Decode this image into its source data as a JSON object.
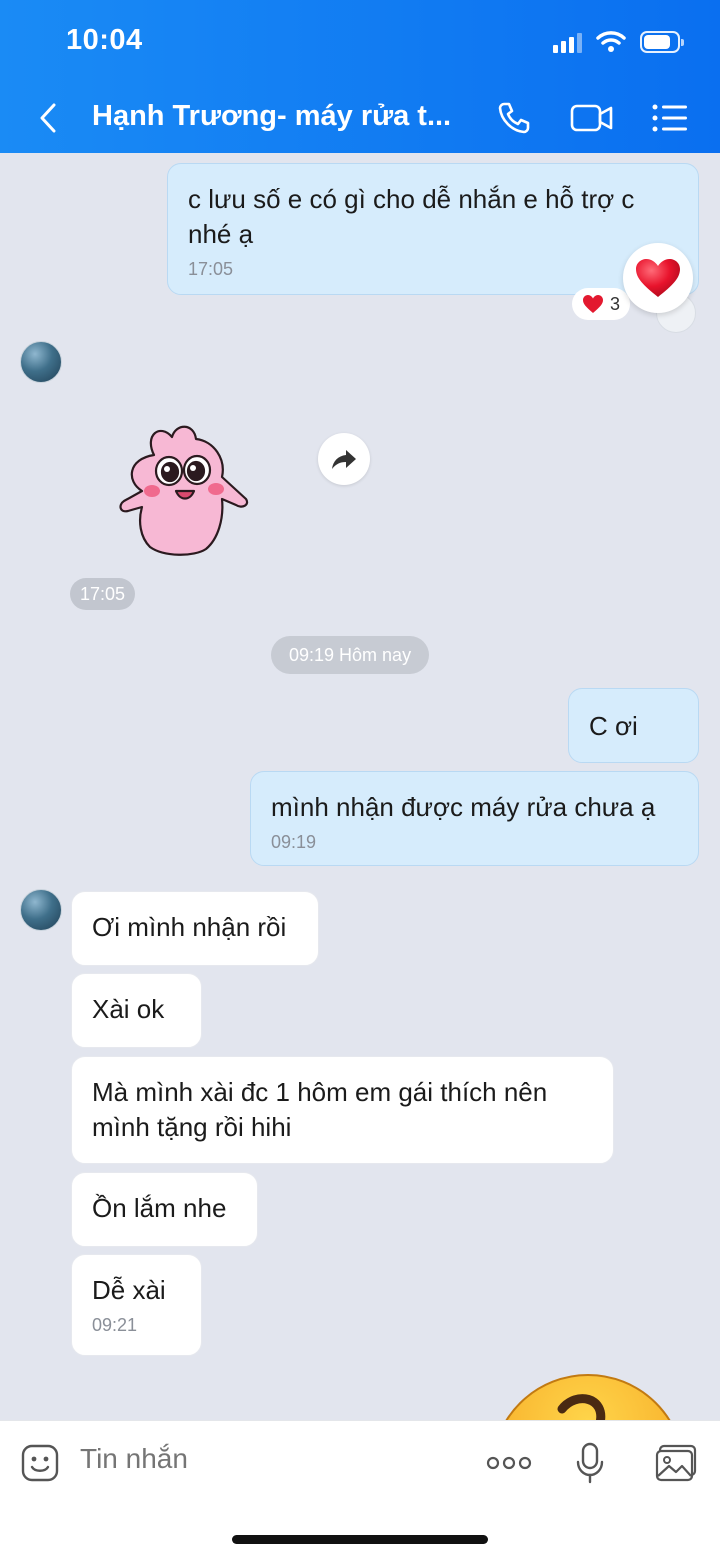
{
  "status_bar": {
    "time": "10:04"
  },
  "header": {
    "title": "Hạnh Trương- máy rửa t..."
  },
  "messages": {
    "m1": {
      "text": "c lưu số e có gì cho dễ nhắn e hỗ trợ c nhé ạ",
      "time": "17:05",
      "reaction_count": "3"
    },
    "sticker_time": "17:05",
    "date_separator": "09:19 Hôm nay",
    "m2": {
      "text": "C ơi"
    },
    "m3": {
      "text": "mình nhận được máy rửa chưa ạ",
      "time": "09:19"
    },
    "r1": {
      "text": "Ơi mình nhận rồi"
    },
    "r2": {
      "text": "Xài ok"
    },
    "r3": {
      "text": "Mà mình xài đc 1 hôm em gái thích nên mình tặng rồi hihi"
    },
    "r4": {
      "text": "Ồn lắm nhe"
    },
    "r5": {
      "text": "Dễ xài",
      "time": "09:21"
    }
  },
  "input": {
    "placeholder": "Tin nhắn"
  },
  "icons": {
    "back": "chevron-left-icon",
    "call": "phone-icon",
    "video": "video-camera-icon",
    "menu": "list-icon",
    "emoji": "emoji-icon",
    "more": "more-icon",
    "mic": "microphone-icon",
    "gallery": "image-icon",
    "forward": "forward-icon",
    "heart": "heart-icon"
  },
  "colors": {
    "header": "#0a6ff0",
    "my_bubble": "#d6ecfc",
    "their_bubble": "#ffffff",
    "background": "#e2e5ee"
  }
}
